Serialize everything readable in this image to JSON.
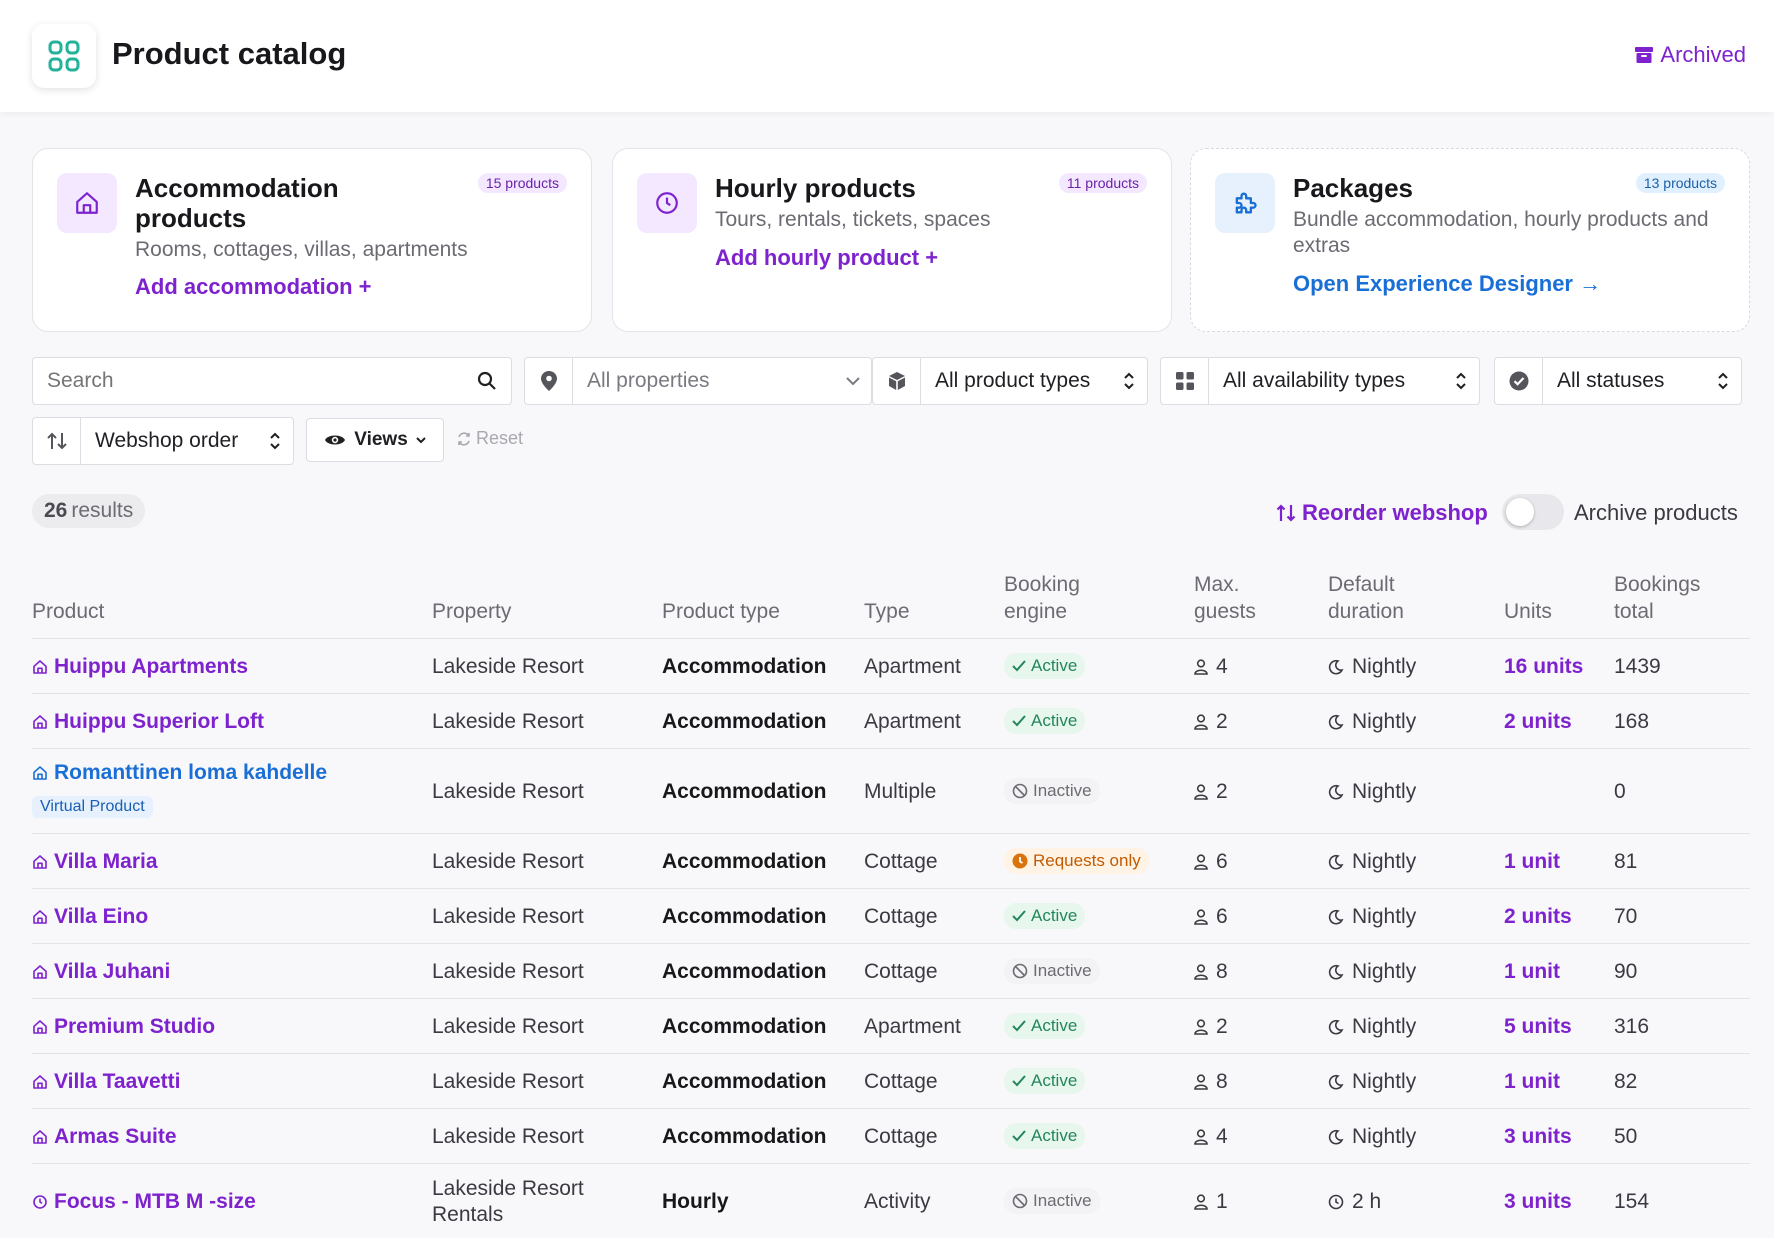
{
  "header": {
    "title": "Product catalog",
    "archived_label": "Archived"
  },
  "cards": [
    {
      "title": "Accommodation products",
      "badge": "15 products",
      "desc": "Rooms, cottages, villas, apartments",
      "link": "Add accommodation +"
    },
    {
      "title": "Hourly products",
      "badge": "11 products",
      "desc": "Tours, rentals, tickets, spaces",
      "link": "Add hourly product +"
    },
    {
      "title": "Packages",
      "badge": "13 products",
      "desc": "Bundle accommodation, hourly products and extras",
      "link": "Open Experience Designer →"
    }
  ],
  "filters": {
    "search_placeholder": "Search",
    "property": "All properties",
    "product_type": "All product types",
    "availability": "All availability types",
    "status": "All statuses",
    "sort": "Webshop order",
    "views": "Views",
    "reset": "Reset"
  },
  "results": {
    "count": "26",
    "label": "results"
  },
  "actions": {
    "reorder": "Reorder webshop",
    "archive_toggle": "Archive products"
  },
  "table": {
    "headers": {
      "product": "Product",
      "property": "Property",
      "product_type": "Product type",
      "type": "Type",
      "booking_1": "Booking",
      "booking_2": "engine",
      "guests_1": "Max.",
      "guests_2": "guests",
      "duration_1": "Default",
      "duration_2": "duration",
      "units": "Units",
      "bookings_1": "Bookings",
      "bookings_2": "total"
    },
    "rows": [
      {
        "product": "Huippu Apartments",
        "property": "Lakeside Resort",
        "product_type": "Accommodation",
        "type": "Apartment",
        "status": "Active",
        "guests": "4",
        "duration": "Nightly",
        "units": "16 units",
        "bookings": "1439"
      },
      {
        "product": "Huippu Superior Loft",
        "property": "Lakeside Resort",
        "product_type": "Accommodation",
        "type": "Apartment",
        "status": "Active",
        "guests": "2",
        "duration": "Nightly",
        "units": "2 units",
        "bookings": "168"
      },
      {
        "product": "Romanttinen loma kahdelle",
        "badge": "Virtual Product",
        "property": "Lakeside Resort",
        "product_type": "Accommodation",
        "type": "Multiple",
        "status": "Inactive",
        "guests": "2",
        "duration": "Nightly",
        "units": "",
        "bookings": "0"
      },
      {
        "product": "Villa Maria",
        "property": "Lakeside Resort",
        "product_type": "Accommodation",
        "type": "Cottage",
        "status": "Requests only",
        "guests": "6",
        "duration": "Nightly",
        "units": "1 unit",
        "bookings": "81"
      },
      {
        "product": "Villa Eino",
        "property": "Lakeside Resort",
        "product_type": "Accommodation",
        "type": "Cottage",
        "status": "Active",
        "guests": "6",
        "duration": "Nightly",
        "units": "2 units",
        "bookings": "70"
      },
      {
        "product": "Villa Juhani",
        "property": "Lakeside Resort",
        "product_type": "Accommodation",
        "type": "Cottage",
        "status": "Inactive",
        "guests": "8",
        "duration": "Nightly",
        "units": "1 unit",
        "bookings": "90"
      },
      {
        "product": "Premium Studio",
        "property": "Lakeside Resort",
        "product_type": "Accommodation",
        "type": "Apartment",
        "status": "Active",
        "guests": "2",
        "duration": "Nightly",
        "units": "5 units",
        "bookings": "316"
      },
      {
        "product": "Villa Taavetti",
        "property": "Lakeside Resort",
        "product_type": "Accommodation",
        "type": "Cottage",
        "status": "Active",
        "guests": "8",
        "duration": "Nightly",
        "units": "1 unit",
        "bookings": "82"
      },
      {
        "product": "Armas Suite",
        "property": "Lakeside Resort",
        "product_type": "Accommodation",
        "type": "Cottage",
        "status": "Active",
        "guests": "4",
        "duration": "Nightly",
        "units": "3 units",
        "bookings": "50"
      },
      {
        "product": "Focus - MTB M -size",
        "property_1": "Lakeside Resort",
        "property_2": "Rentals",
        "product_type": "Hourly",
        "type": "Activity",
        "status": "Inactive",
        "guests": "1",
        "duration": "2 h",
        "units": "3 units",
        "bookings": "154"
      }
    ]
  },
  "colors": {
    "accent": "#7e22ce",
    "blue_link": "#1a6fd6",
    "active": "#23865a",
    "requests": "#c25b00"
  }
}
